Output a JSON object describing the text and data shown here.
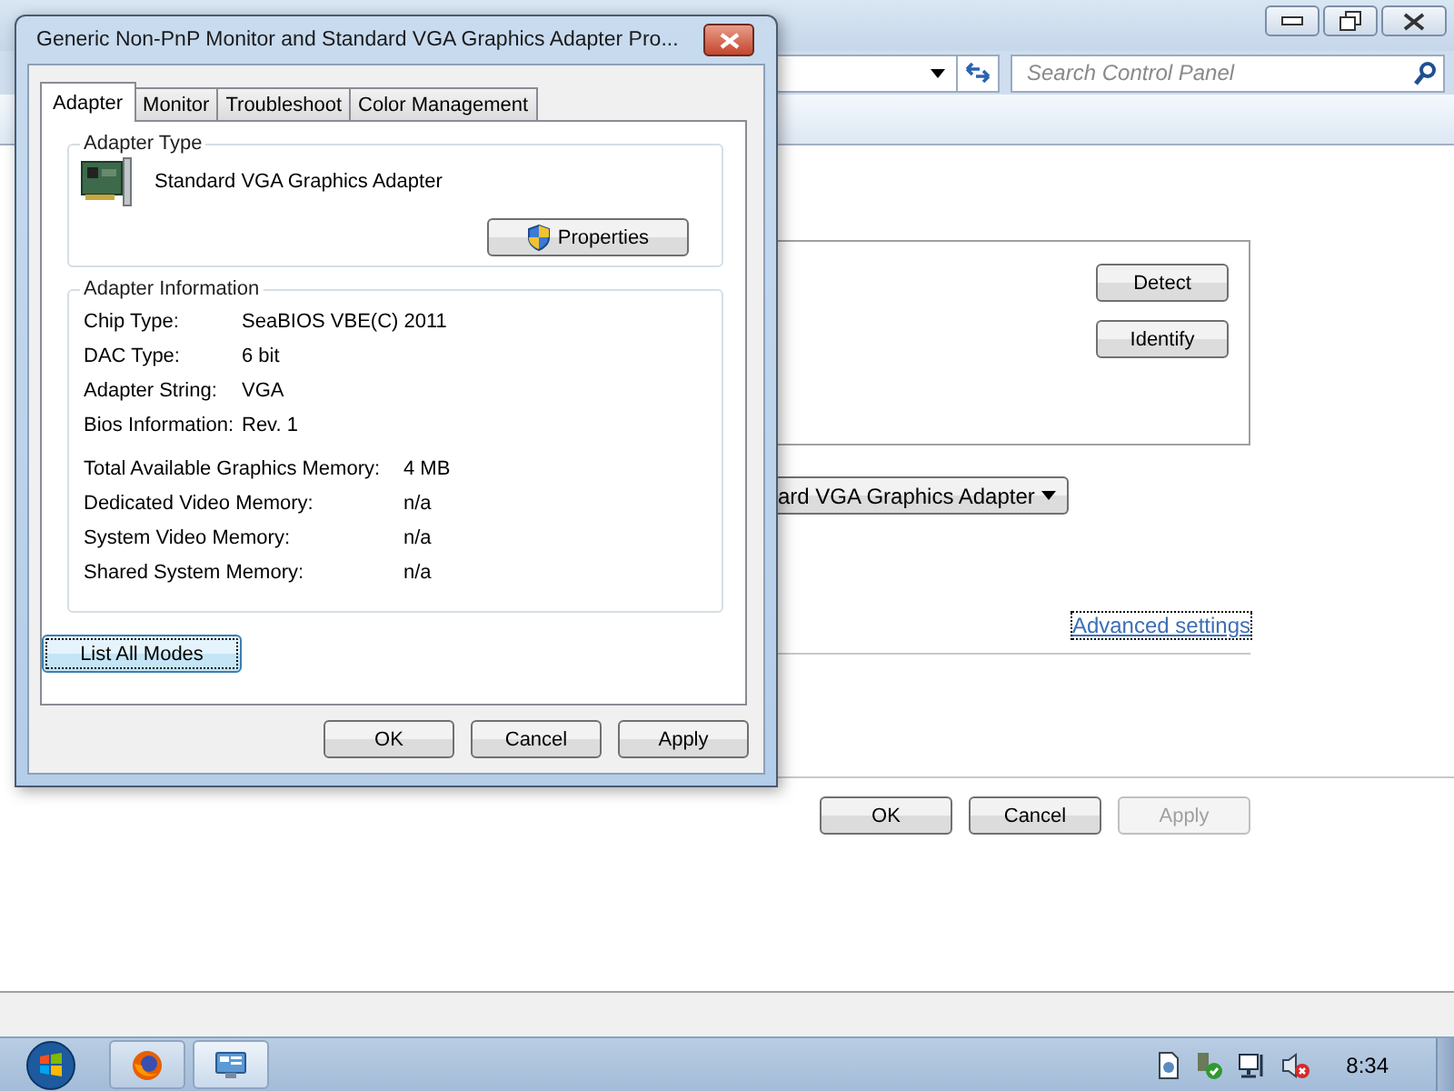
{
  "background_window": {
    "search": {
      "placeholder": "Search Control Panel"
    },
    "side_buttons": [
      "Detect",
      "Identify"
    ],
    "adapter_dropdown": {
      "value": "ard VGA Graphics Adapter"
    },
    "advanced_link": "Advanced settings",
    "buttons": [
      {
        "label": "OK",
        "disabled": false
      },
      {
        "label": "Cancel",
        "disabled": false
      },
      {
        "label": "Apply",
        "disabled": true
      }
    ]
  },
  "dialog": {
    "title": "Generic Non-PnP Monitor and Standard VGA Graphics Adapter Pro...",
    "tabs": [
      {
        "label": "Adapter",
        "selected": true
      },
      {
        "label": "Monitor",
        "selected": false
      },
      {
        "label": "Troubleshoot",
        "selected": false
      },
      {
        "label": "Color Management",
        "selected": false
      }
    ],
    "adapter_type": {
      "heading": "Adapter Type",
      "name": "Standard VGA Graphics Adapter",
      "properties_button": "Properties"
    },
    "adapter_information": {
      "heading": "Adapter Information",
      "rows": [
        {
          "label": "Chip Type:",
          "value": "SeaBIOS VBE(C) 2011"
        },
        {
          "label": "DAC Type:",
          "value": "6 bit"
        },
        {
          "label": "Adapter String:",
          "value": "VGA"
        },
        {
          "label": "Bios Information:",
          "value": "Rev. 1"
        }
      ],
      "memory_rows": [
        {
          "label": "Total Available Graphics Memory:",
          "value": "4 MB"
        },
        {
          "label": "Dedicated Video Memory:",
          "value": "n/a"
        },
        {
          "label": "System Video Memory:",
          "value": "n/a"
        },
        {
          "label": "Shared System Memory:",
          "value": "n/a"
        }
      ]
    },
    "list_modes_button": {
      "label": "List All Modes",
      "focused": true
    },
    "buttons": [
      {
        "label": "OK",
        "disabled": false
      },
      {
        "label": "Cancel",
        "disabled": false
      },
      {
        "label": "Apply",
        "disabled": false
      }
    ]
  },
  "taskbar": {
    "clock": "8:34"
  }
}
